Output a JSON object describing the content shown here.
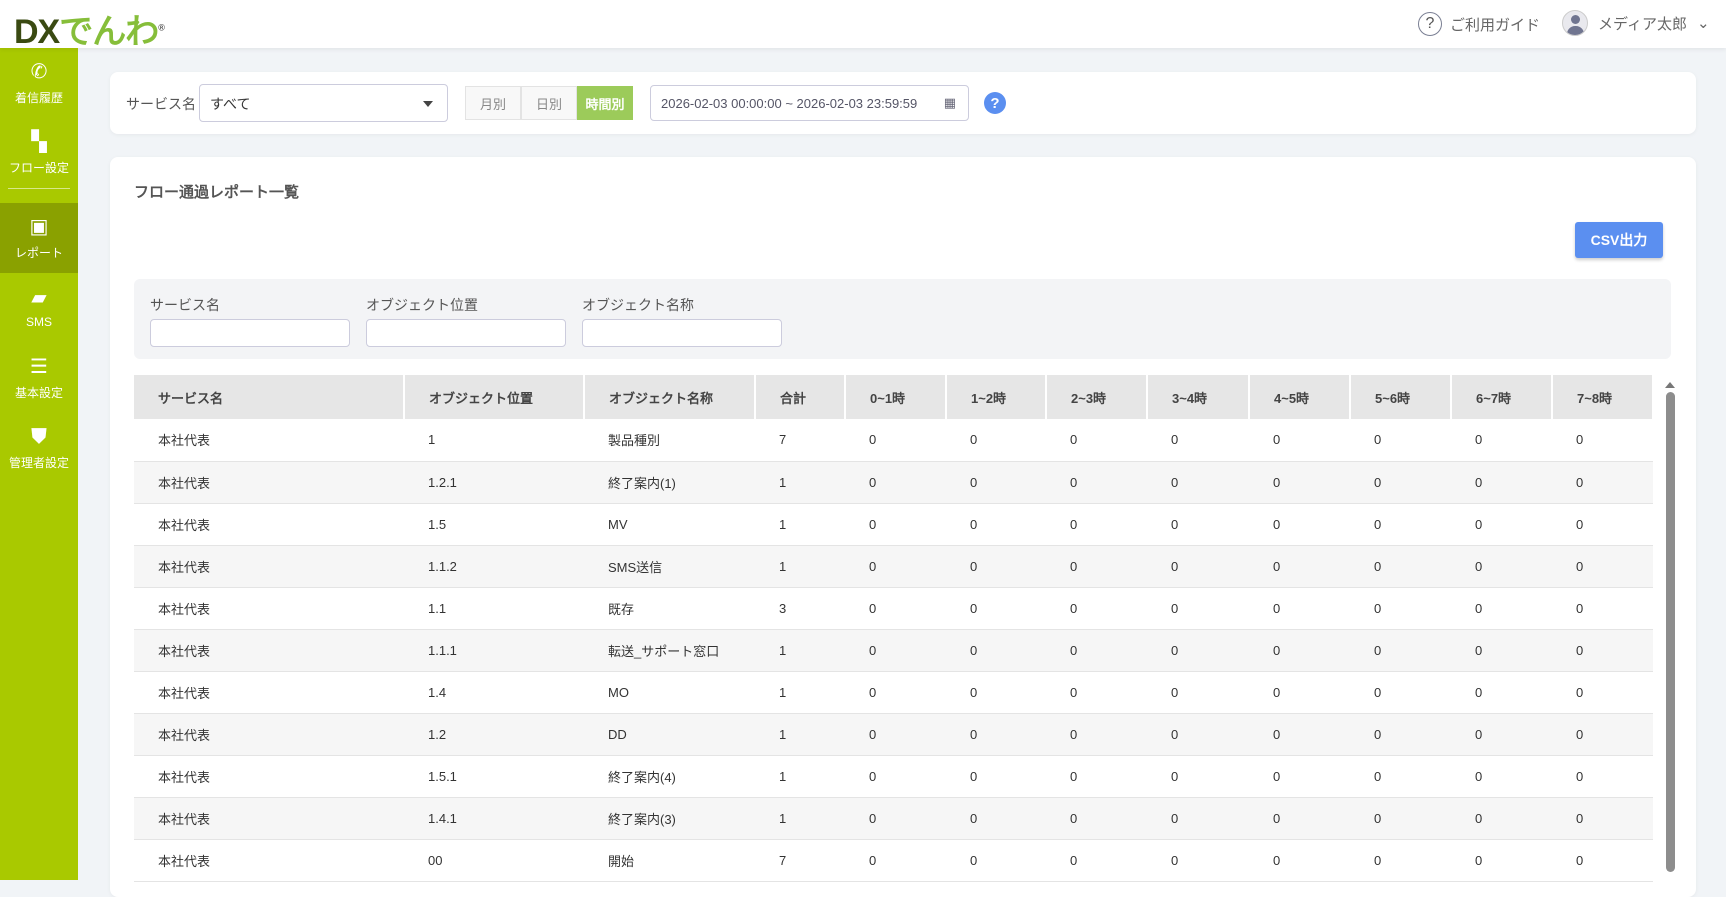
{
  "header": {
    "logo_dx": "DX",
    "logo_rest": "でんわ",
    "guide": "ご利用ガイド",
    "user": "メディア太郎"
  },
  "sidebar": {
    "items": [
      {
        "label": "着信履歴",
        "icon": "phone-icon"
      },
      {
        "label": "フロー設定",
        "icon": "flow-icon"
      },
      {
        "label": "レポート",
        "icon": "report-icon",
        "active": true
      },
      {
        "label": "SMS",
        "icon": "sms-icon"
      },
      {
        "label": "基本設定",
        "icon": "sliders-icon"
      },
      {
        "label": "管理者設定",
        "icon": "admin-shield-icon"
      }
    ]
  },
  "filter": {
    "service_label": "サービス名",
    "service_value": "すべて",
    "periods": [
      "月別",
      "日別",
      "時間別"
    ],
    "active_period": "時間別",
    "date_range": "2026-02-03 00:00:00 ~ 2026-02-03 23:59:59"
  },
  "report": {
    "title": "フロー通過レポート一覧",
    "csv": "CSV出力",
    "filters": [
      {
        "label": "サービス名",
        "value": ""
      },
      {
        "label": "オブジェクト位置",
        "value": ""
      },
      {
        "label": "オブジェクト名称",
        "value": ""
      }
    ],
    "columns": [
      "サービス名",
      "オブジェクト位置",
      "オブジェクト名称",
      "合計",
      "0~1時",
      "1~2時",
      "2~3時",
      "3~4時",
      "4~5時",
      "5~6時",
      "6~7時",
      "7~8時"
    ],
    "rows": [
      [
        "本社代表",
        "1",
        "製品種別",
        "7",
        "0",
        "0",
        "0",
        "0",
        "0",
        "0",
        "0",
        "0"
      ],
      [
        "本社代表",
        "1.2.1",
        "終了案内(1)",
        "1",
        "0",
        "0",
        "0",
        "0",
        "0",
        "0",
        "0",
        "0"
      ],
      [
        "本社代表",
        "1.5",
        "MV",
        "1",
        "0",
        "0",
        "0",
        "0",
        "0",
        "0",
        "0",
        "0"
      ],
      [
        "本社代表",
        "1.1.2",
        "SMS送信",
        "1",
        "0",
        "0",
        "0",
        "0",
        "0",
        "0",
        "0",
        "0"
      ],
      [
        "本社代表",
        "1.1",
        "既存",
        "3",
        "0",
        "0",
        "0",
        "0",
        "0",
        "0",
        "0",
        "0"
      ],
      [
        "本社代表",
        "1.1.1",
        "転送_サポート窓口",
        "1",
        "0",
        "0",
        "0",
        "0",
        "0",
        "0",
        "0",
        "0"
      ],
      [
        "本社代表",
        "1.4",
        "MO",
        "1",
        "0",
        "0",
        "0",
        "0",
        "0",
        "0",
        "0",
        "0"
      ],
      [
        "本社代表",
        "1.2",
        "DD",
        "1",
        "0",
        "0",
        "0",
        "0",
        "0",
        "0",
        "0",
        "0"
      ],
      [
        "本社代表",
        "1.5.1",
        "終了案内(4)",
        "1",
        "0",
        "0",
        "0",
        "0",
        "0",
        "0",
        "0",
        "0"
      ],
      [
        "本社代表",
        "1.4.1",
        "終了案内(3)",
        "1",
        "0",
        "0",
        "0",
        "0",
        "0",
        "0",
        "0",
        "0"
      ],
      [
        "本社代表",
        "00",
        "開始",
        "7",
        "0",
        "0",
        "0",
        "0",
        "0",
        "0",
        "0",
        "0"
      ]
    ]
  }
}
